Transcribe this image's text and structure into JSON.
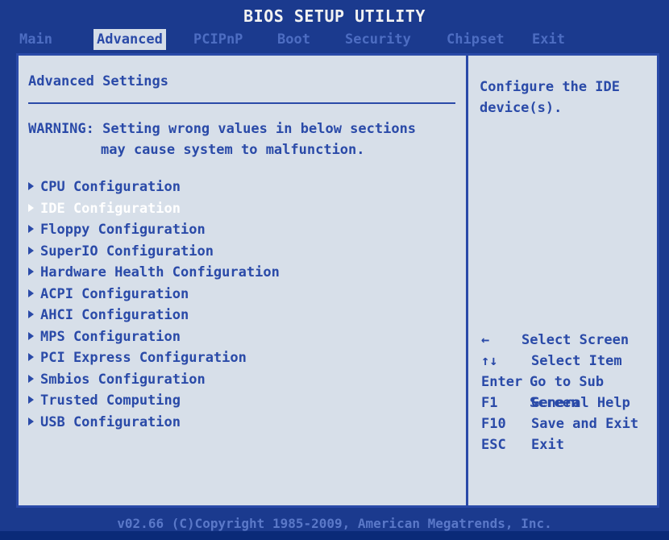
{
  "header": {
    "title": "BIOS SETUP UTILITY"
  },
  "menu": {
    "items": [
      {
        "label": "Main"
      },
      {
        "label": "Advanced"
      },
      {
        "label": "PCIPnP"
      },
      {
        "label": "Boot"
      },
      {
        "label": "Security"
      },
      {
        "label": "Chipset"
      },
      {
        "label": "Exit"
      }
    ],
    "active": "Advanced"
  },
  "main": {
    "title": "Advanced Settings",
    "warning_line1": "WARNING: Setting wrong values in below sections",
    "warning_line2": "may cause system to malfunction.",
    "items": [
      {
        "label": "CPU Configuration"
      },
      {
        "label": "IDE Configuration"
      },
      {
        "label": "Floppy Configuration"
      },
      {
        "label": "SuperIO Configuration"
      },
      {
        "label": "Hardware Health Configuration"
      },
      {
        "label": "ACPI Configuration"
      },
      {
        "label": "AHCI Configuration"
      },
      {
        "label": "MPS Configuration"
      },
      {
        "label": "PCI Express Configuration"
      },
      {
        "label": "Smbios Configuration"
      },
      {
        "label": "Trusted Computing"
      },
      {
        "label": "USB Configuration"
      }
    ],
    "selected": "IDE Configuration"
  },
  "help": {
    "line1": "Configure the IDE",
    "line2": "device(s)."
  },
  "keys": [
    {
      "key": "←",
      "desc": "Select Screen"
    },
    {
      "key": "↑↓",
      "desc": "Select Item"
    },
    {
      "key": "Enter",
      "desc": "Go to Sub Screen"
    },
    {
      "key": "F1",
      "desc": "General Help"
    },
    {
      "key": "F10",
      "desc": "Save and Exit"
    },
    {
      "key": "ESC",
      "desc": "Exit"
    }
  ],
  "footer": {
    "text": "v02.66 (C)Copyright 1985-2009, American Megatrends, Inc."
  },
  "colors": {
    "background": "#1b3a8e",
    "panel": "#d7dfe9",
    "text": "#2a4aa8",
    "highlight": "#ffffff"
  }
}
